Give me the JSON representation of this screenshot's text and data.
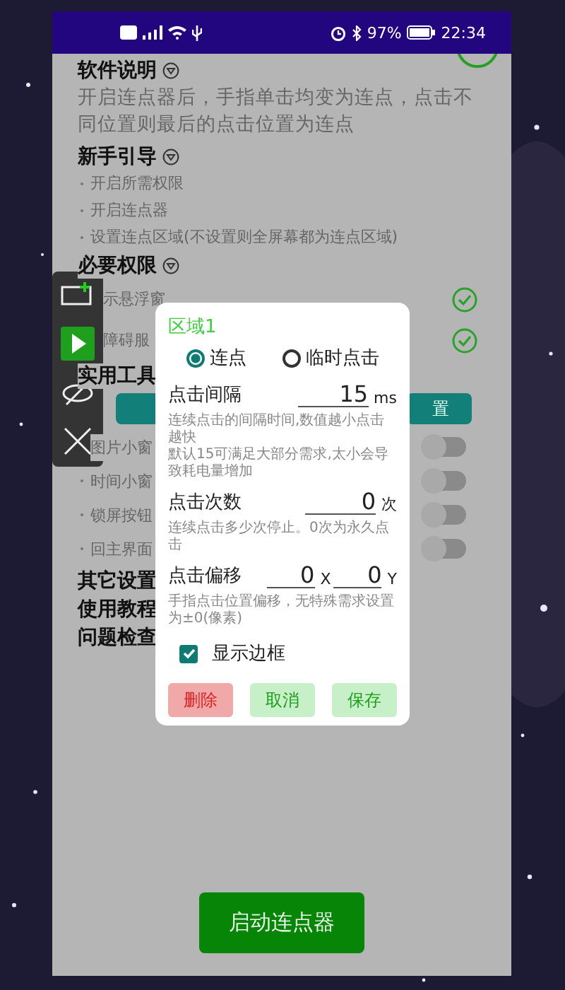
{
  "status_bar": {
    "battery": "97%",
    "time": "22:34"
  },
  "sections": [
    {
      "kind": "paragraph",
      "title": "软件说明",
      "text": "开启连点器后，手指单击均变为连点，点击不同位置则最后的点击位置为连点"
    },
    {
      "kind": "steps",
      "title": "新手引导",
      "items": [
        "开启所需权限",
        "开启连点器",
        "设置连点区域(不设置则全屏幕都为连点区域)"
      ]
    },
    {
      "kind": "permissions",
      "title": "必要权限",
      "items": [
        {
          "label": "示悬浮窗",
          "granted": true
        },
        {
          "label": "障碍服",
          "granted": true
        }
      ]
    },
    {
      "kind": "tools",
      "title": "实用工具",
      "button_label": "置",
      "toggles": [
        {
          "label": "图片小窗",
          "on": false
        },
        {
          "label": "时间小窗",
          "on": false
        },
        {
          "label": "锁屏按钮",
          "on": false
        },
        {
          "label": "回主界面",
          "on": false
        }
      ]
    },
    {
      "kind": "link",
      "title": "其它设置"
    },
    {
      "kind": "link",
      "title": "使用教程"
    },
    {
      "kind": "link",
      "title": "问题检查"
    }
  ],
  "start_button": "启动连点器",
  "dialog": {
    "title": "区域1",
    "radios": [
      {
        "label": "连点",
        "selected": true
      },
      {
        "label": "临时点击",
        "selected": false
      }
    ],
    "fields": [
      {
        "kind": "single",
        "label": "点击间隔",
        "value": "15",
        "unit": "ms",
        "hint_lines": [
          "连续点击的间隔时间,数值越小点击越快",
          "默认15可满足大部分需求,太小会导致耗电量增加"
        ]
      },
      {
        "kind": "single",
        "label": "点击次数",
        "value": "0",
        "unit": "次",
        "hint_lines": [
          "连续点击多少次停止。0次为永久点击"
        ]
      },
      {
        "kind": "pair",
        "label": "点击偏移",
        "values": [
          {
            "value": "0",
            "unit": "X"
          },
          {
            "value": "0",
            "unit": "Y"
          }
        ],
        "hint_lines": [
          "手指点击位置偏移，无特殊需求设置为±0(像素)"
        ]
      }
    ],
    "checkbox": {
      "label": "显示边框",
      "checked": true
    },
    "buttons": [
      {
        "label": "删除",
        "kind": "danger"
      },
      {
        "label": "取消",
        "kind": "normal"
      },
      {
        "label": "保存",
        "kind": "normal"
      }
    ]
  }
}
